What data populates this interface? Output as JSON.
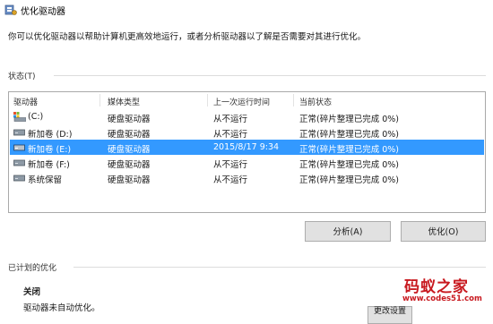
{
  "window": {
    "title": "优化驱动器"
  },
  "description": "你可以优化驱动器以帮助计算机更高效地运行，或者分析驱动器以了解是否需要对其进行优化。",
  "status_group": {
    "label": "状态(T)"
  },
  "drive_list": {
    "headers": [
      "驱动器",
      "媒体类型",
      "上一次运行时间",
      "当前状态"
    ],
    "rows": [
      {
        "drive": "(C:)",
        "media": "硬盘驱动器",
        "last_run": "从不运行",
        "status": "正常(碎片整理已完成 0%)",
        "icon": "system-drive-icon",
        "selected": false
      },
      {
        "drive": "新加卷 (D:)",
        "media": "硬盘驱动器",
        "last_run": "从不运行",
        "status": "正常(碎片整理已完成 0%)",
        "icon": "hard-drive-icon",
        "selected": false
      },
      {
        "drive": "新加卷 (E:)",
        "media": "硬盘驱动器",
        "last_run": "2015/8/17 9:34",
        "status": "正常(碎片整理已完成 0%)",
        "icon": "hard-drive-icon",
        "selected": true
      },
      {
        "drive": "新加卷 (F:)",
        "media": "硬盘驱动器",
        "last_run": "从不运行",
        "status": "正常(碎片整理已完成 0%)",
        "icon": "hard-drive-icon",
        "selected": false
      },
      {
        "drive": "系统保留",
        "media": "硬盘驱动器",
        "last_run": "从不运行",
        "status": "正常(碎片整理已完成 0%)",
        "icon": "hard-drive-icon",
        "selected": false
      }
    ]
  },
  "buttons": {
    "analyze": "分析(A)",
    "optimize": "优化(O)",
    "partial": "更改设置"
  },
  "scheduled": {
    "group_label": "已计划的优化",
    "state": "关闭",
    "detail": "驱动器未自动优化。"
  },
  "watermark": {
    "main": "码蚁之家",
    "url": "www.codes51.com"
  },
  "colors": {
    "selection": "#3399ff",
    "watermark": "#c8191f"
  }
}
